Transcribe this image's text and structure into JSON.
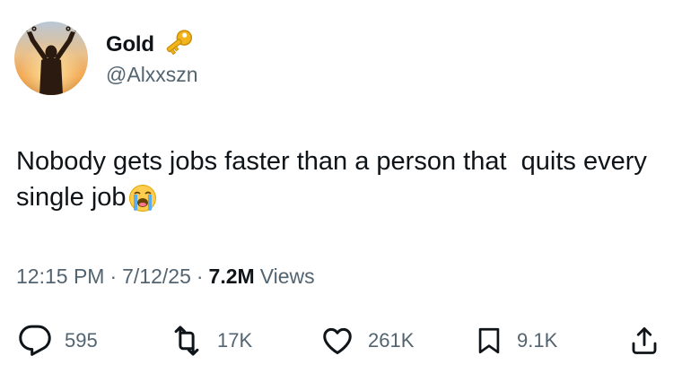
{
  "user": {
    "display_name": "Gold",
    "badge_icon": "key-emoji",
    "handle": "@Alxxszn",
    "avatar_icon": "person-raising-arms-sunset-avatar"
  },
  "tweet": {
    "text": "Nobody gets jobs faster than a person that  quits every single job",
    "trailing_emoji": "loudly-crying-face-emoji"
  },
  "meta": {
    "time": "12:15 PM",
    "separator": "·",
    "date": "7/12/25",
    "views_count": "7.2M",
    "views_label": "Views"
  },
  "actions": {
    "replies": "595",
    "reposts": "17K",
    "likes": "261K",
    "bookmarks": "9.1K"
  },
  "colors": {
    "text_primary": "#0f1419",
    "text_secondary": "#536471",
    "key_gold": "#f2b51b"
  }
}
